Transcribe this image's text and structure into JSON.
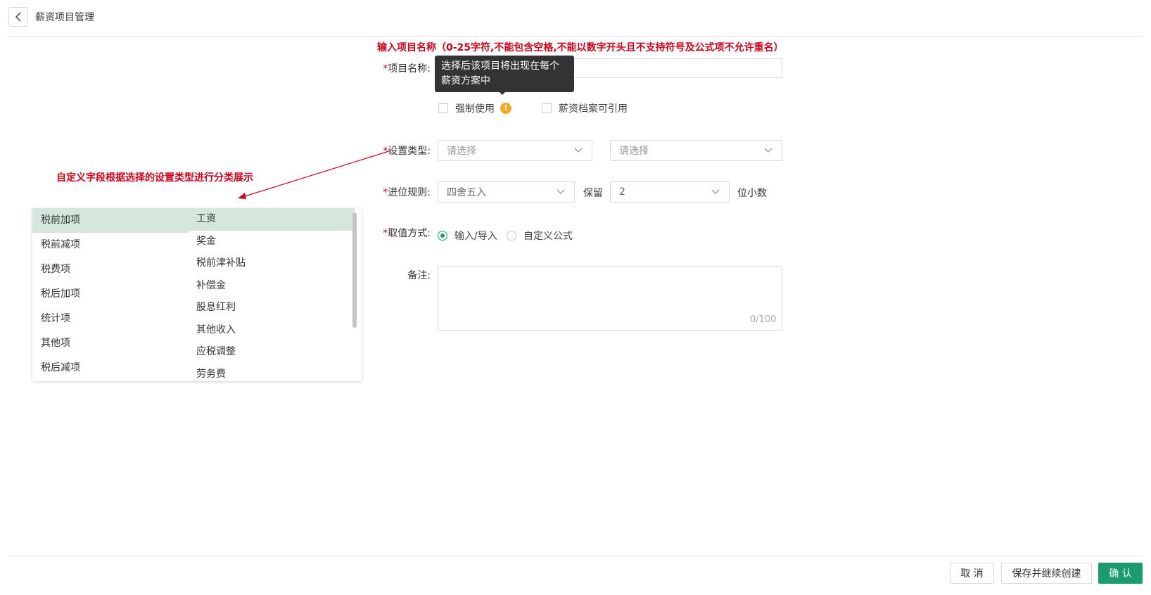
{
  "header": {
    "title": "薪资项目管理"
  },
  "annotations": {
    "name_rule": "输入项目名称（0-25字符,不能包含空格,不能以数字开头且不支持符号及公式项不允许重名）",
    "category_note": "自定义字段根据选择的设置类型进行分类展示"
  },
  "form": {
    "required_mark": "*",
    "name": {
      "label": "项目名称:",
      "value": ""
    },
    "tooltip": "选择后该项目将出现在每个薪资方案中",
    "force_use": {
      "label": "强制使用",
      "info_glyph": "!"
    },
    "archive_ref": {
      "label": "薪资档案可引用"
    },
    "type": {
      "label": "设置类型:",
      "placeholder1": "请选择",
      "placeholder2": "请选择"
    },
    "rounding": {
      "label": "进位规则:",
      "value": "四舍五入",
      "keep_label": "保留",
      "decimals": "2",
      "suffix": "位小数"
    },
    "value_mode": {
      "label": "取值方式:",
      "option1": "输入/导入",
      "option2": "自定义公式"
    },
    "remark": {
      "label": "备注:",
      "counter": "0/100"
    }
  },
  "category_panel": {
    "left": [
      "税前加项",
      "税前减项",
      "税费项",
      "税后加项",
      "统计项",
      "其他项",
      "税后减项"
    ],
    "right": [
      "工资",
      "奖金",
      "税前津补贴",
      "补偿金",
      "股息红利",
      "其他收入",
      "应税调整",
      "劳务费"
    ]
  },
  "footer": {
    "cancel": "取 消",
    "save_continue": "保存并继续创建",
    "confirm": "确 认"
  },
  "colors": {
    "primary": "#1a9c6c",
    "annotation": "#d0021b",
    "selected_bg": "#d5e6dc",
    "info": "#f5a623"
  }
}
